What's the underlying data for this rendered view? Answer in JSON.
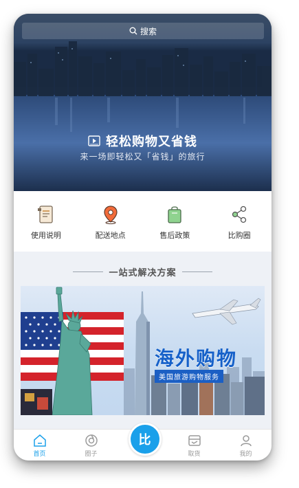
{
  "search": {
    "label": "搜索",
    "icon": "search-icon"
  },
  "hero": {
    "title": "轻松购物又省钱",
    "subtitle": "来一场即轻松又「省钱」的旅行",
    "icon": "video-icon"
  },
  "quick_nav": [
    {
      "label": "使用说明",
      "icon": "document-icon"
    },
    {
      "label": "配送地点",
      "icon": "location-pin-icon"
    },
    {
      "label": "售后政策",
      "icon": "shopping-bag-icon"
    },
    {
      "label": "比购圈",
      "icon": "share-icon"
    }
  ],
  "section": {
    "title": "一站式解决方案"
  },
  "banner": {
    "title": "海外购物",
    "subtitle": "美国旅游购物服务"
  },
  "tabbar": {
    "items": [
      {
        "label": "首页",
        "icon": "home-icon",
        "active": true
      },
      {
        "label": "圈子",
        "icon": "circle-icon",
        "active": false
      },
      {
        "label": "比",
        "icon": "center-logo-icon",
        "active": false
      },
      {
        "label": "取货",
        "icon": "pickup-icon",
        "active": false
      },
      {
        "label": "我的",
        "icon": "profile-icon",
        "active": false
      }
    ]
  },
  "colors": {
    "accent": "#1aa0ea",
    "banner_title": "#1560c9",
    "hero_dark": "#1b2c47"
  }
}
